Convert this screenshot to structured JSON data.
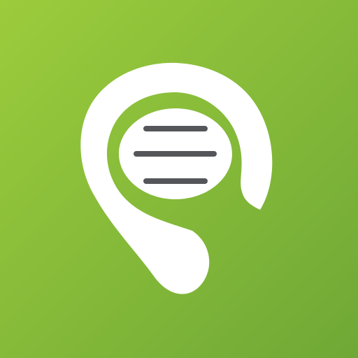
{
  "icon": {
    "name": "ear-speech-icon",
    "colors": {
      "background_top_left": "#9ccc3c",
      "background_bottom_right": "#6fa836",
      "ear_fill": "#ffffff",
      "lines_stroke": "#555659"
    }
  }
}
